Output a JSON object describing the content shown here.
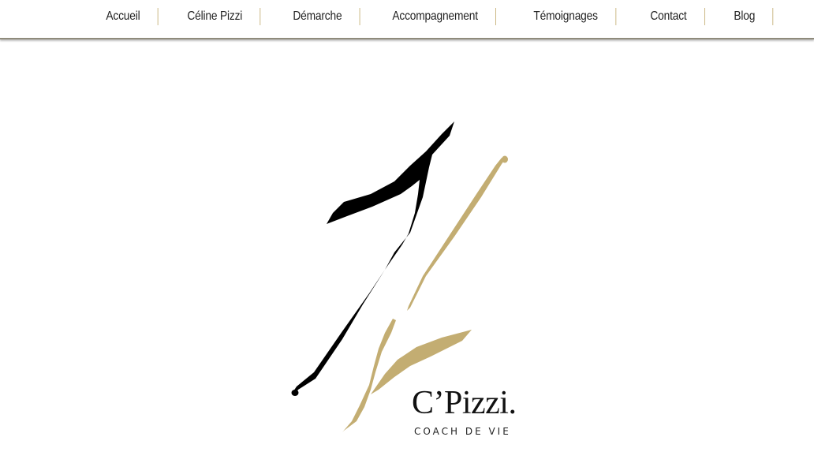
{
  "nav": {
    "items": [
      {
        "label": "Accueil"
      },
      {
        "label": "Céline Pizzi"
      },
      {
        "label": "Démarche"
      },
      {
        "label": "Accompagnement"
      },
      {
        "label": "Témoignages"
      },
      {
        "label": "Contact"
      },
      {
        "label": "Blog"
      }
    ],
    "separator_color": "#c3ad72"
  },
  "logo": {
    "name": "C’Pizzi.",
    "tagline": "COACH DE VIE",
    "colors": {
      "black": "#000000",
      "gold": "#c3ad72"
    }
  }
}
